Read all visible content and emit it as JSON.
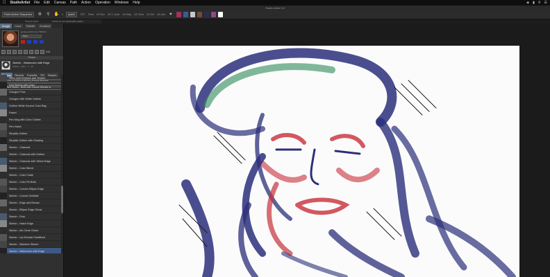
{
  "menubar": {
    "apple": "",
    "app": "StudioArtist",
    "items": [
      "File",
      "Edit",
      "Canvas",
      "Path",
      "Action",
      "Operation",
      "Windows",
      "Help"
    ]
  },
  "window_title": "Studio Artist 5.5",
  "toolbar": {
    "sequence_select": "Paint Action Sequence",
    "zoom_value": "1",
    "zoom_box": "ipad1",
    "paint_label": "Paint",
    "buttons": [
      "AS Run",
      "AS 1 Cycle",
      "AS Step",
      "AS Clear",
      "AS Del",
      "AS Add"
    ],
    "swatches": [
      "#a0325c",
      "#3c5a96",
      "#c8c8c8",
      "#6e4b3b",
      "#2d2d4a",
      "#8a4a8c",
      "#ffffff"
    ]
  },
  "subbar": {
    "source_label": "Source Area",
    "tooltip": "press to run automatic action"
  },
  "sidebar": {
    "tabs": [
      "Image",
      "Color",
      "Palette",
      "Gradient"
    ],
    "active_tab": "Image",
    "source_info": "pexels-ashish-thui-7686141",
    "source_mode": "Paint",
    "mini_value": "418",
    "preset_header": "Preset",
    "preset_name": "Sketch - Watercolor with Edge",
    "preset_sub": [
      "PASeq",
      "action",
      "1",
      "16"
    ],
    "filter_tabs": [
      "Factory",
      "Recent",
      "Favorite",
      "PS",
      "Search"
    ],
    "active_filter": "Factory",
    "category_dropdown": "Movies or Still Art PASeq Simple Presets",
    "subcategory_dropdown": "Sketch Styles - Best with Source Movies or",
    "items": [
      "Neon with Emboss and Texture",
      "Noir Sketch with Color",
      "Octogon Frizz",
      "Octogon with White Outline",
      "Outline White Source Color Bkg",
      "Pastel",
      "Pen Neg with Color Outline",
      "Pen Hatch",
      "Simplify Outline",
      "Simplify Outline with Shading",
      "Sketch - Charcoal",
      "Sketch - Charcoal with Outline",
      "Sketch - Charcoal with Yellow Edge",
      "Sketch - Color Blend",
      "Sketch - Color Chalk",
      "Sketch - Color Fill Brite",
      "Sketch - Convex Ellipse Edge",
      "Sketch - Convex Scribble",
      "Sketch - Edge and Blouse",
      "Sketch - Ellipse Edge Ghost",
      "Sketch - Frizz",
      "Sketch - Hatch Edge",
      "Sketch - Ink Circle Ghost",
      "Sketch - Lip Extrude Paintfixed",
      "Sketch - Skeleton Sketch",
      "Sketch - Watercolor with Edge"
    ],
    "selected_item": "Sketch - Watercolor with Edge"
  },
  "colors": {
    "accent": "#3d5a86",
    "stroke_blue": "#2b2f7a",
    "stroke_red": "#c8303a",
    "stroke_green": "#2f8a5a"
  }
}
